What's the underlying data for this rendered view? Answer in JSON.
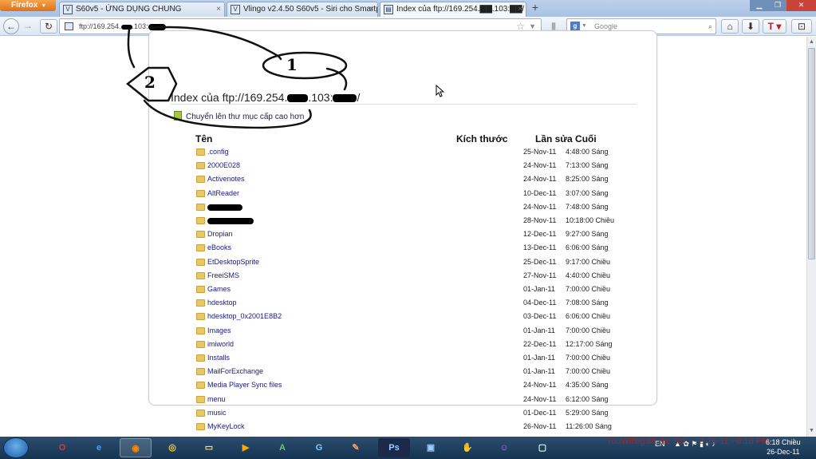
{
  "browser": {
    "menu_button": "Firefox",
    "tabs": [
      {
        "title": "S60v5 - ỨNG DỤNG CHUNG"
      },
      {
        "title": "Vlingo v2.4.50 S60v5 - Siri cho Smartp..."
      },
      {
        "title": "Index của ftp://169.254.▇▇.103:▇▇/"
      }
    ],
    "new_tab": "+",
    "url": "ftp://169.254.",
    "url_suffix": ".103:",
    "search_placeholder": "Google"
  },
  "page": {
    "heading": "Index của ftp://169.254.",
    "heading_mid": ".103:",
    "heading_end": "/",
    "up_link": "Chuyển lên thư mục cấp cao hơn",
    "columns": {
      "name": "Tên",
      "size": "Kích thước",
      "modified": "Lần sửa Cuối"
    },
    "rows": [
      {
        "name": ".config",
        "date": "25-Nov-11",
        "time": "4:48:00 Sáng"
      },
      {
        "name": "2000E028",
        "date": "24-Nov-11",
        "time": "7:13:00 Sáng"
      },
      {
        "name": "Activenotes",
        "date": "24-Nov-11",
        "time": "8:25:00 Sáng"
      },
      {
        "name": "AltReader",
        "date": "10-Dec-11",
        "time": "3:07:00 Sáng"
      },
      {
        "name": "",
        "date": "24-Nov-11",
        "time": "7:48:00 Sáng",
        "redacted": true
      },
      {
        "name": "",
        "date": "28-Nov-11",
        "time": "10:18:00 Chiều",
        "redacted": true
      },
      {
        "name": "Dropian",
        "date": "12-Dec-11",
        "time": "9:27:00 Sáng"
      },
      {
        "name": "eBooks",
        "date": "13-Dec-11",
        "time": "6:06:00 Sáng"
      },
      {
        "name": "EtDesktopSprite",
        "date": "25-Dec-11",
        "time": "9:17:00 Chiều"
      },
      {
        "name": "FreeiSMS",
        "date": "27-Nov-11",
        "time": "4:40:00 Chiều"
      },
      {
        "name": "Games",
        "date": "01-Jan-11",
        "time": "7:00:00 Chiều"
      },
      {
        "name": "hdesktop",
        "date": "04-Dec-11",
        "time": "7:08:00 Sáng"
      },
      {
        "name": "hdesktop_0x2001E8B2",
        "date": "03-Dec-11",
        "time": "6:06:00 Chiều"
      },
      {
        "name": "Images",
        "date": "01-Jan-11",
        "time": "7:00:00 Chiều"
      },
      {
        "name": "imiworld",
        "date": "22-Dec-11",
        "time": "12:17:00 Sáng"
      },
      {
        "name": "Installs",
        "date": "01-Jan-11",
        "time": "7:00:00 Chiều"
      },
      {
        "name": "MailForExchange",
        "date": "01-Jan-11",
        "time": "7:00:00 Chiều"
      },
      {
        "name": "Media Player Sync files",
        "date": "24-Nov-11",
        "time": "4:35:00 Sáng"
      },
      {
        "name": "menu",
        "date": "24-Nov-11",
        "time": "6:12:00 Sáng"
      },
      {
        "name": "music",
        "date": "01-Dec-11",
        "time": "5:29:00 Sáng"
      },
      {
        "name": "MyKeyLock",
        "date": "26-Nov-11",
        "time": "11:26:00 Sáng"
      }
    ]
  },
  "annotations": {
    "label_1": "1",
    "label_2": "2"
  },
  "taskbar": {
    "language": "EN",
    "time": "6:18 Chiều",
    "date": "26-Dec-11",
    "watermark": "YouWillegalIt.Inc Scr - 12-26-11 - 6:18 PM",
    "app_labels": {
      "photoshop": "Ps"
    }
  },
  "colors": {
    "link": "#1a1a7e",
    "folder": "#e8c767",
    "taskbar": "#143451"
  }
}
